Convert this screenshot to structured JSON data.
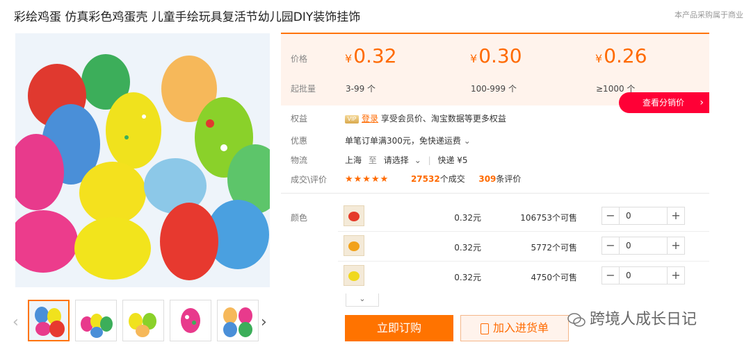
{
  "product": {
    "title": "彩绘鸡蛋 仿真彩色鸡蛋壳 儿童手绘玩具复活节幼儿园DIY装饰挂饰",
    "notice": "本产品采购属于商业"
  },
  "colors": {
    "accent": "#ff7300",
    "price": "#ff6a00",
    "dist_btn": "#ff0036"
  },
  "pricing": {
    "price_label": "价格",
    "moq_label": "起批量",
    "currency": "¥",
    "tiers": [
      {
        "price": "0.32",
        "range": "3-99 个"
      },
      {
        "price": "0.30",
        "range": "100-999 个"
      },
      {
        "price": "0.26",
        "range": "≥1000 个"
      }
    ],
    "dist_button": "查看分销价"
  },
  "info": {
    "benefit_label": "权益",
    "benefit_login": "登录",
    "benefit_text": "享受会员价、淘宝数据等更多权益",
    "promo_label": "优惠",
    "promo_text": "单笔订单满300元，免快递运费",
    "logistics_label": "物流",
    "origin": "上海",
    "to": "至",
    "destination_select": "请选择",
    "shipping": "快递 ¥5",
    "deals_label": "成交\\评价",
    "stars": "★★★★★",
    "deals_count": "27532",
    "deals_unit": "个成交",
    "reviews_count": "309",
    "reviews_unit": "条评价"
  },
  "variants": {
    "label": "颜色",
    "rows": [
      {
        "price": "0.32元",
        "stock": "106753个可售",
        "qty": "0",
        "swatch_color": "#e53a2a"
      },
      {
        "price": "0.32元",
        "stock": "5772个可售",
        "qty": "0",
        "swatch_color": "#f2a21b"
      },
      {
        "price": "0.32元",
        "stock": "4750个可售",
        "qty": "0",
        "swatch_color": "#f0d81e"
      }
    ]
  },
  "actions": {
    "buy": "立即订购",
    "cart": "加入进货单"
  },
  "watermark": "跨境人成长日记"
}
